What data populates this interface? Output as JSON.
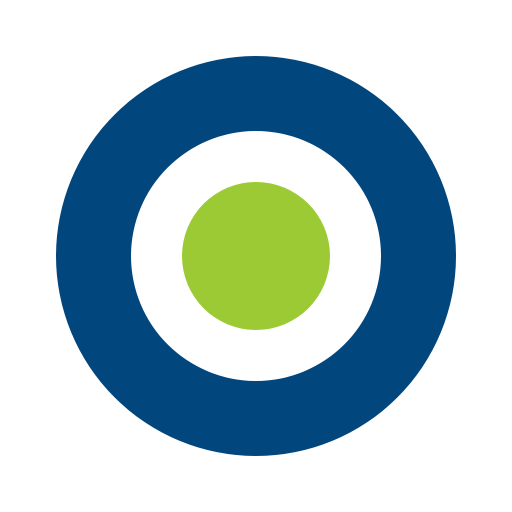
{
  "logo": {
    "icon": "target-roundel-icon",
    "colors": {
      "outer_ring": "#02467e",
      "inner_ring": "#ffffff",
      "center_dot": "#9bca34",
      "background": "#ffffff"
    }
  }
}
